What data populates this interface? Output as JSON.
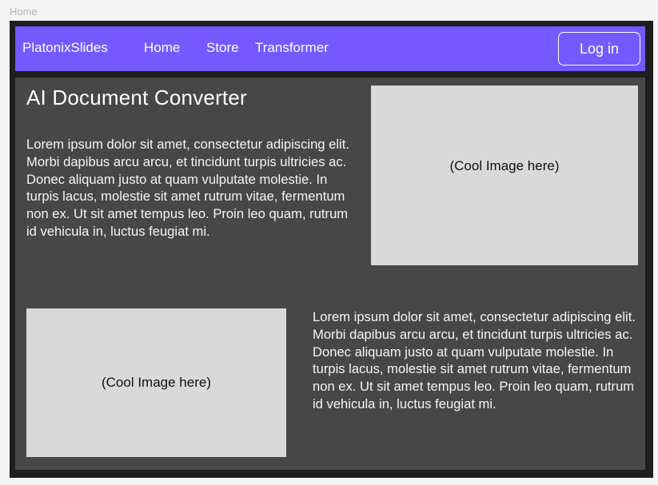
{
  "frame_label": "Home",
  "navbar": {
    "brand": "PlatonixSlides",
    "links": [
      "Home",
      "Store",
      "Transformer"
    ],
    "login_label": "Log in"
  },
  "main": {
    "title": "AI Document Converter",
    "paragraph_1": "Lorem ipsum dolor sit amet, consectetur adipiscing elit. Morbi dapibus arcu arcu, et tincidunt turpis ultricies ac. Donec aliquam justo at quam vulputate molestie. In turpis lacus, molestie sit amet rutrum vitae, fermentum non ex. Ut sit amet tempus leo. Proin leo quam, rutrum id vehicula in, luctus feugiat mi.",
    "image_1_label": "(Cool Image here)",
    "image_2_label": "(Cool Image here)",
    "paragraph_2": "Lorem ipsum dolor sit amet, consectetur adipiscing elit. Morbi dapibus arcu arcu, et tincidunt turpis ultricies ac. Donec aliquam justo at quam vulputate molestie. In turpis lacus, molestie sit amet rutrum vitae, fermentum non ex. Ut sit amet tempus leo. Proin leo quam, rutrum id vehicula in, luctus feugiat mi."
  },
  "colors": {
    "navbar": "#7559ff",
    "content_background": "#474747",
    "frame_border": "#1e1e1e",
    "image_placeholder": "#d9d9d9"
  }
}
